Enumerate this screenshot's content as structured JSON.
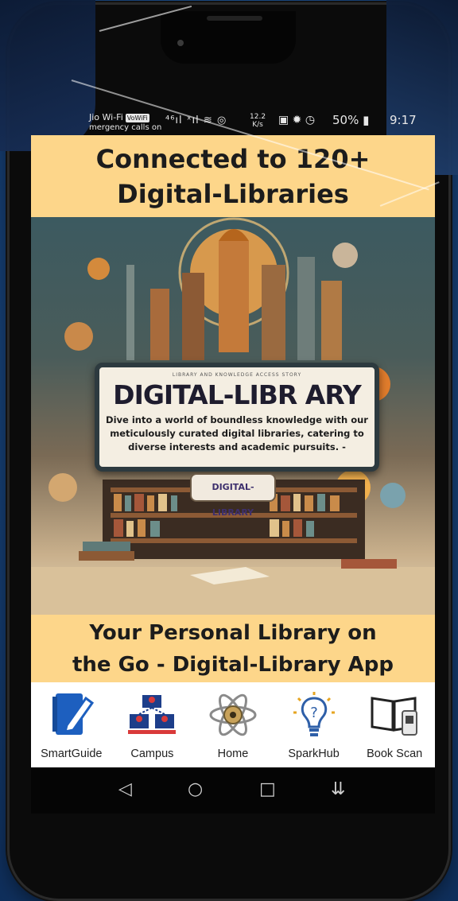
{
  "status_bar": {
    "carrier": "Jio Wi-Fi",
    "carrier_badge": "VoWiFi",
    "carrier_sub": "mergency calls on",
    "signal": "⁴⁶ıl ˣıl",
    "net_speed_value": "12.2",
    "net_speed_unit": "K/s",
    "battery": "50%",
    "time": "9:17"
  },
  "top_banner": {
    "line1": "Connected to 120+",
    "line2": "Digital-Libraries"
  },
  "hero": {
    "tiny_text": "LIBRARY AND KNOWLEDGE ACCESS STORY",
    "title": "DIGITAL-LIBR ARY",
    "description_line1": "Dive into a world of boundless knowledge with our",
    "description_line2": "meticulously curated digital libraries, catering to",
    "description_line3": "diverse interests and academic pursuits. -",
    "pill_label": "DIGITAL-LIBRARY"
  },
  "bottom_banner": {
    "line1": "Your Personal Library on",
    "line2": "the Go - Digital-Library App"
  },
  "nav": [
    {
      "label": "SmartGuide",
      "icon": "smartguide-icon"
    },
    {
      "label": "Campus",
      "icon": "campus-icon"
    },
    {
      "label": "Home",
      "icon": "home-atom-icon"
    },
    {
      "label": "SparkHub",
      "icon": "sparkhub-bulb-icon"
    },
    {
      "label": "Book Scan",
      "icon": "book-scan-icon"
    }
  ],
  "colors": {
    "banner": "#fdd68a",
    "nav_bg": "#ffffff",
    "icon_blue": "#1d5fbf"
  }
}
